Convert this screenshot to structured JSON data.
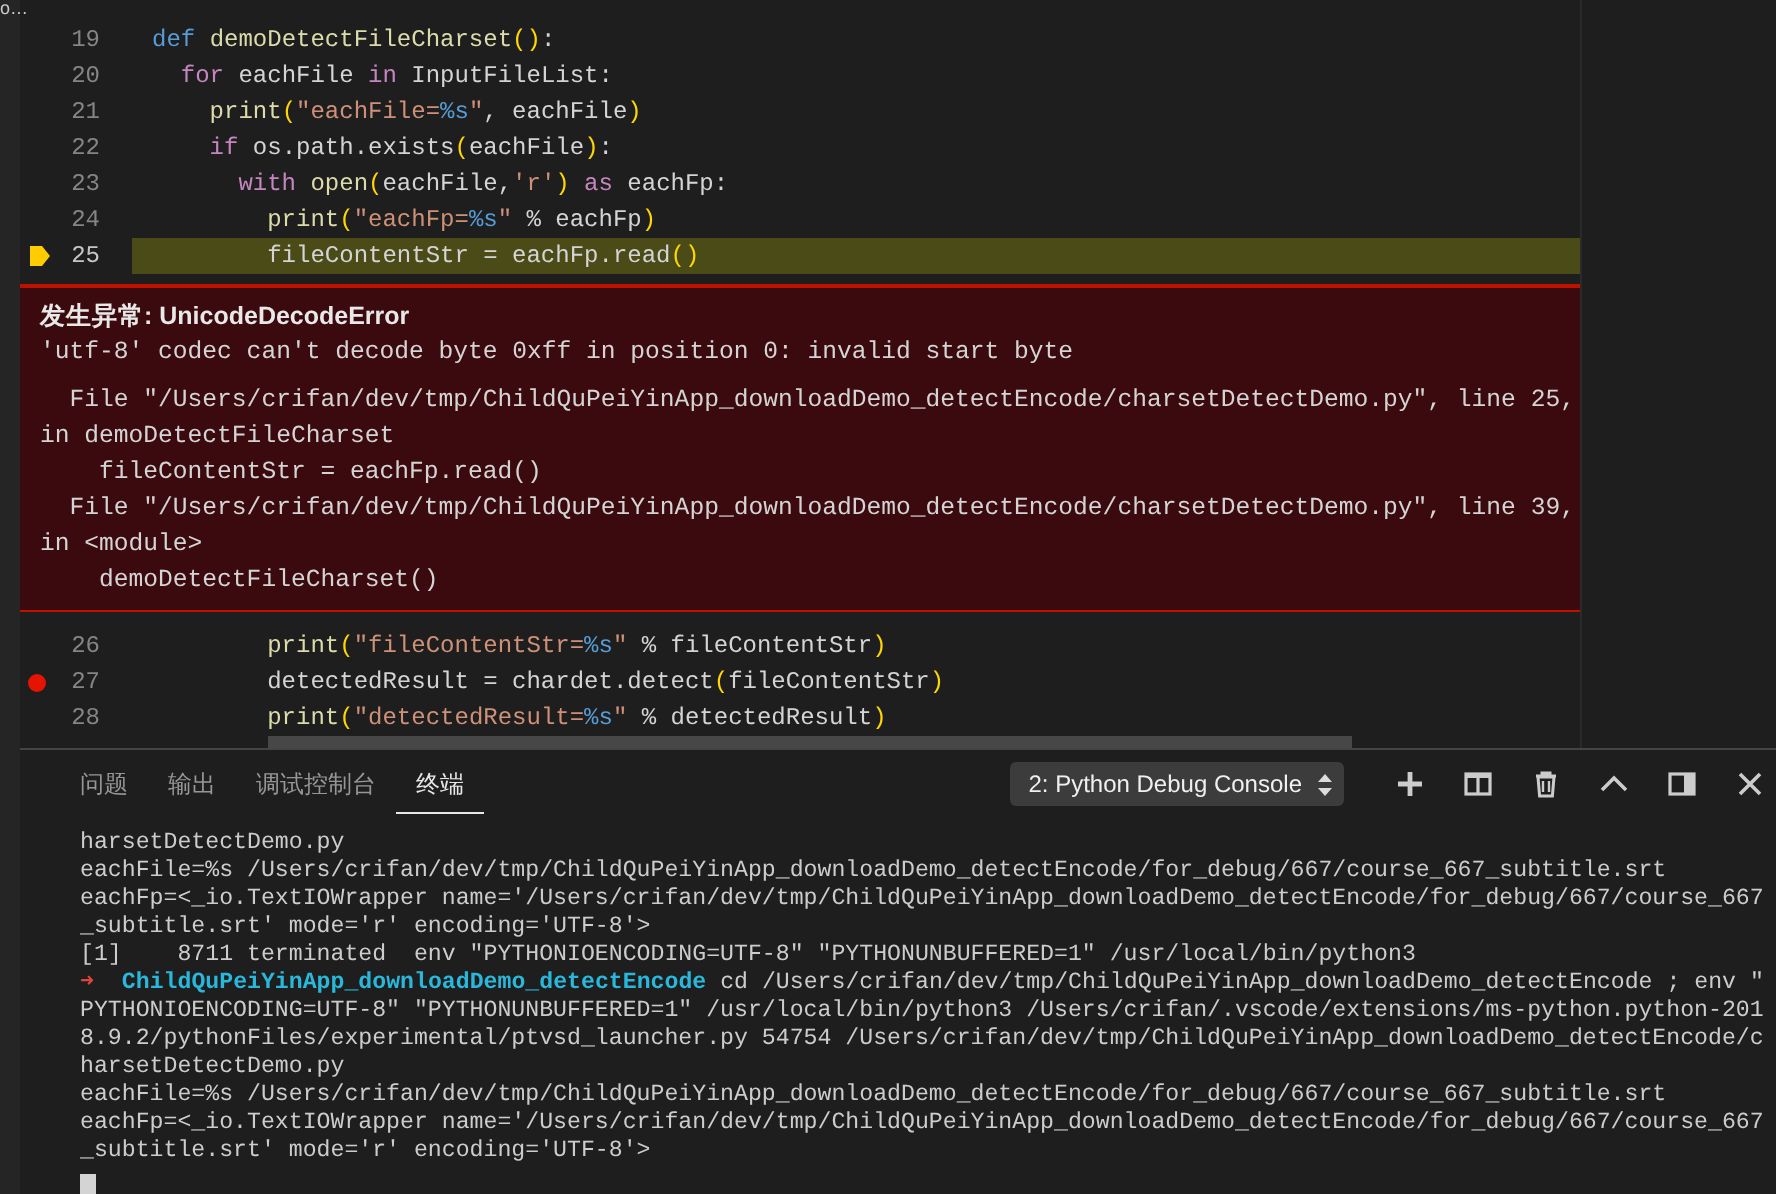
{
  "sidebar_fragment": "o…",
  "editor": {
    "lines_top": [
      {
        "number": "19",
        "current": false,
        "breakpoint": false,
        "tokens": [
          {
            "t": "def ",
            "kind": "def"
          },
          {
            "t": "demoDetectFileCharset",
            "kind": "fn"
          },
          {
            "t": "()",
            "kind": "paren"
          },
          {
            "t": ":",
            "kind": "plain"
          }
        ]
      },
      {
        "number": "20",
        "current": false,
        "breakpoint": false,
        "tokens": [
          {
            "t": "  for ",
            "kind": "kw"
          },
          {
            "t": "eachFile ",
            "kind": "plain"
          },
          {
            "t": "in ",
            "kind": "kw"
          },
          {
            "t": "InputFileList:",
            "kind": "plain"
          }
        ]
      },
      {
        "number": "21",
        "current": false,
        "breakpoint": false,
        "tokens": [
          {
            "t": "    print",
            "kind": "fn"
          },
          {
            "t": "(",
            "kind": "paren"
          },
          {
            "t": "\"eachFile=",
            "kind": "str"
          },
          {
            "t": "%s",
            "kind": "fmt"
          },
          {
            "t": "\"",
            "kind": "str"
          },
          {
            "t": ", eachFile",
            "kind": "plain"
          },
          {
            "t": ")",
            "kind": "paren"
          }
        ]
      },
      {
        "number": "22",
        "current": false,
        "breakpoint": false,
        "tokens": [
          {
            "t": "    if ",
            "kind": "kw"
          },
          {
            "t": "os.path.exists",
            "kind": "plain"
          },
          {
            "t": "(",
            "kind": "paren"
          },
          {
            "t": "eachFile",
            "kind": "plain"
          },
          {
            "t": ")",
            "kind": "paren"
          },
          {
            "t": ":",
            "kind": "plain"
          }
        ]
      },
      {
        "number": "23",
        "current": false,
        "breakpoint": false,
        "tokens": [
          {
            "t": "      with ",
            "kind": "kw"
          },
          {
            "t": "open",
            "kind": "fn"
          },
          {
            "t": "(",
            "kind": "paren"
          },
          {
            "t": "eachFile,",
            "kind": "plain"
          },
          {
            "t": "'r'",
            "kind": "str"
          },
          {
            "t": ")",
            "kind": "paren"
          },
          {
            "t": " as ",
            "kind": "kw"
          },
          {
            "t": "eachFp:",
            "kind": "plain"
          }
        ]
      },
      {
        "number": "24",
        "current": false,
        "breakpoint": false,
        "tokens": [
          {
            "t": "        print",
            "kind": "fn"
          },
          {
            "t": "(",
            "kind": "paren"
          },
          {
            "t": "\"eachFp=",
            "kind": "str"
          },
          {
            "t": "%s",
            "kind": "fmt"
          },
          {
            "t": "\"",
            "kind": "str"
          },
          {
            "t": " % eachFp",
            "kind": "plain"
          },
          {
            "t": ")",
            "kind": "paren"
          }
        ]
      },
      {
        "number": "25",
        "current": true,
        "breakpoint": false,
        "tokens": [
          {
            "t": "        fileContentStr = eachFp.read",
            "kind": "plain"
          },
          {
            "t": "()",
            "kind": "paren"
          }
        ]
      }
    ],
    "exception": {
      "title": "发生异常: UnicodeDecodeError",
      "message": "'utf-8' codec can't decode byte 0xff in position 0: invalid start byte",
      "traceback": [
        "  File \"/Users/crifan/dev/tmp/ChildQuPeiYinApp_downloadDemo_detectEncode/charsetDetectDemo.py\", line 25,",
        "in demoDetectFileCharset",
        "    fileContentStr = eachFp.read()",
        "  File \"/Users/crifan/dev/tmp/ChildQuPeiYinApp_downloadDemo_detectEncode/charsetDetectDemo.py\", line 39,",
        "in <module>",
        "    demoDetectFileCharset()"
      ]
    },
    "lines_bottom": [
      {
        "number": "26",
        "current": false,
        "breakpoint": false,
        "tokens": [
          {
            "t": "        print",
            "kind": "fn"
          },
          {
            "t": "(",
            "kind": "paren"
          },
          {
            "t": "\"fileContentStr=",
            "kind": "str"
          },
          {
            "t": "%s",
            "kind": "fmt"
          },
          {
            "t": "\"",
            "kind": "str"
          },
          {
            "t": " % fileContentStr",
            "kind": "plain"
          },
          {
            "t": ")",
            "kind": "paren"
          }
        ]
      },
      {
        "number": "27",
        "current": false,
        "breakpoint": true,
        "tokens": [
          {
            "t": "        detectedResult = chardet.detect",
            "kind": "plain"
          },
          {
            "t": "(",
            "kind": "paren"
          },
          {
            "t": "fileContentStr",
            "kind": "plain"
          },
          {
            "t": ")",
            "kind": "paren"
          }
        ]
      },
      {
        "number": "28",
        "current": false,
        "breakpoint": false,
        "tokens": [
          {
            "t": "        print",
            "kind": "fn"
          },
          {
            "t": "(",
            "kind": "paren"
          },
          {
            "t": "\"detectedResult=",
            "kind": "str"
          },
          {
            "t": "%s",
            "kind": "fmt"
          },
          {
            "t": "\"",
            "kind": "str"
          },
          {
            "t": " % detectedResult",
            "kind": "plain"
          },
          {
            "t": ")",
            "kind": "paren"
          }
        ]
      }
    ]
  },
  "panel": {
    "tabs": [
      {
        "label": "问题",
        "selected": false
      },
      {
        "label": "输出",
        "selected": false
      },
      {
        "label": "调试控制台",
        "selected": false
      },
      {
        "label": "终端",
        "selected": true
      }
    ],
    "terminal_select": "2: Python Debug Console",
    "terminal": [
      {
        "kind": "text",
        "text": "harsetDetectDemo.py"
      },
      {
        "kind": "text",
        "text": "eachFile=%s /Users/crifan/dev/tmp/ChildQuPeiYinApp_downloadDemo_detectEncode/for_debug/667/course_667_subtitle.srt"
      },
      {
        "kind": "text",
        "text": "eachFp=<_io.TextIOWrapper name='/Users/crifan/dev/tmp/ChildQuPeiYinApp_downloadDemo_detectEncode/for_debug/667/course_667"
      },
      {
        "kind": "text",
        "text": "_subtitle.srt' mode='r' encoding='UTF-8'>"
      },
      {
        "kind": "text",
        "text": "[1]    8711 terminated  env \"PYTHONIOENCODING=UTF-8\" \"PYTHONUNBUFFERED=1\" /usr/local/bin/python3"
      },
      {
        "kind": "prompt",
        "arrow": "➜",
        "dir": "ChildQuPeiYinApp_downloadDemo_detectEncode",
        "text": "cd /Users/crifan/dev/tmp/ChildQuPeiYinApp_downloadDemo_detectEncode ; env \""
      },
      {
        "kind": "text",
        "text": "PYTHONIOENCODING=UTF-8\" \"PYTHONUNBUFFERED=1\" /usr/local/bin/python3 /Users/crifan/.vscode/extensions/ms-python.python-201"
      },
      {
        "kind": "text",
        "text": "8.9.2/pythonFiles/experimental/ptvsd_launcher.py 54754 /Users/crifan/dev/tmp/ChildQuPeiYinApp_downloadDemo_detectEncode/c"
      },
      {
        "kind": "text",
        "text": "harsetDetectDemo.py"
      },
      {
        "kind": "text",
        "text": "eachFile=%s /Users/crifan/dev/tmp/ChildQuPeiYinApp_downloadDemo_detectEncode/for_debug/667/course_667_subtitle.srt"
      },
      {
        "kind": "text",
        "text": "eachFp=<_io.TextIOWrapper name='/Users/crifan/dev/tmp/ChildQuPeiYinApp_downloadDemo_detectEncode/for_debug/667/course_667"
      },
      {
        "kind": "text",
        "text": "_subtitle.srt' mode='r' encoding='UTF-8'>"
      },
      {
        "kind": "cursor"
      }
    ]
  }
}
